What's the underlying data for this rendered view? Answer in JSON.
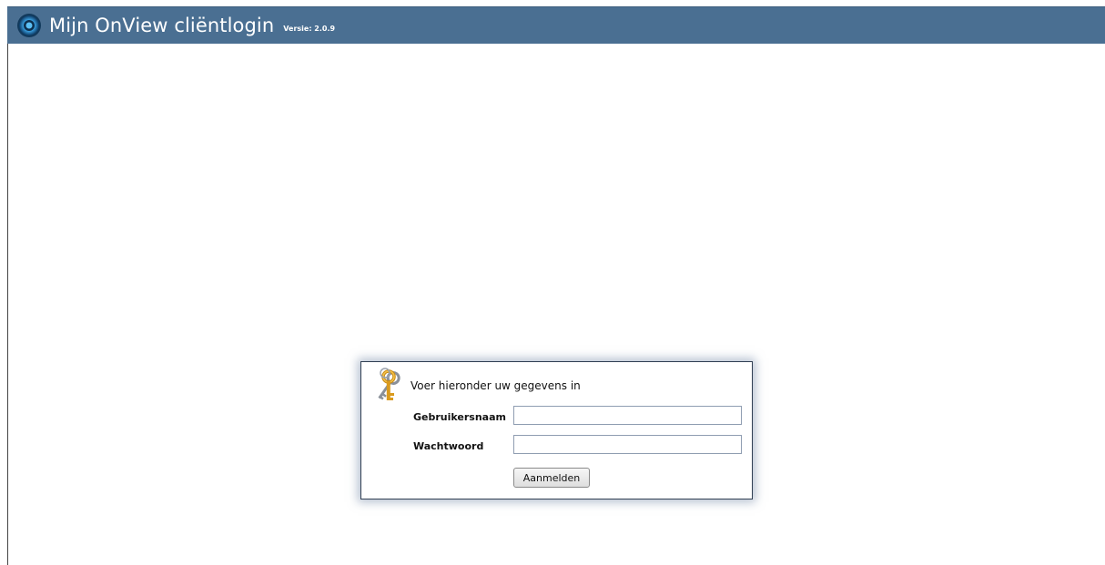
{
  "header": {
    "logo_icon": "onview-circle-logo-icon",
    "title": "Mijn OnView cliëntlogin",
    "version": "Versie: 2.0.9",
    "background_color": "#4a6f92"
  },
  "login": {
    "icon": "keys-icon",
    "prompt": "Voer hieronder uw gegevens in",
    "username_label": "Gebruikersnaam",
    "username_value": "",
    "password_label": "Wachtwoord",
    "password_value": "",
    "submit_label": "Aanmelden"
  }
}
